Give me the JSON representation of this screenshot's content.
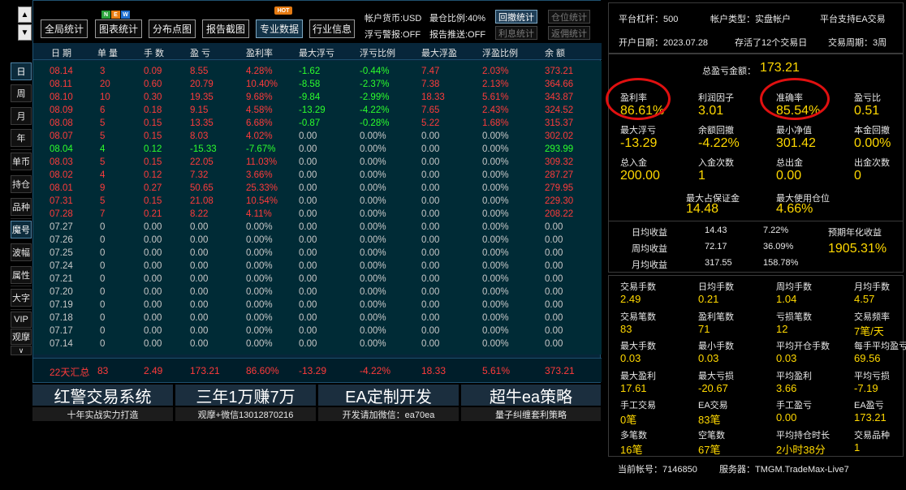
{
  "sidebar": {
    "up_arrow": "▲",
    "down_arrow": "▼",
    "buttons": [
      "日",
      "周",
      "月",
      "年",
      "单币",
      "持仓",
      "品种",
      "魔号",
      "波幅",
      "属性",
      "大字",
      "VIP",
      "观摩"
    ],
    "collapse": "∨"
  },
  "toolbar": {
    "buttons": [
      "全局统计",
      "图表统计",
      "分布点图",
      "报告截图",
      "专业数据",
      "行业信息"
    ],
    "new_badge": [
      "N",
      "E",
      "W"
    ],
    "hot_badge": "HOT",
    "account_currency": "帐户货币:USD",
    "max_position_ratio": "最仓比例:40%",
    "float_loss_alert": "浮亏警报:OFF",
    "report_push": "报告推送:OFF",
    "small_buttons": [
      "回撤统计",
      "仓位统计",
      "利息统计",
      "返佣统计"
    ]
  },
  "table": {
    "headers": [
      "日 期",
      "单 量",
      "手 数",
      "盈 亏",
      "盈利率",
      "最大浮亏",
      "浮亏比例",
      "最大浮盈",
      "浮盈比例",
      "余 额"
    ],
    "rows": [
      [
        "08.14",
        "3",
        "0.09",
        "8.55",
        "4.28%",
        "-1.62",
        "-0.44%",
        "7.47",
        "2.03%",
        "373.21"
      ],
      [
        "08.11",
        "20",
        "0.60",
        "20.79",
        "10.40%",
        "-8.58",
        "-2.37%",
        "7.38",
        "2.13%",
        "364.66"
      ],
      [
        "08.10",
        "10",
        "0.30",
        "19.35",
        "9.68%",
        "-9.84",
        "-2.99%",
        "18.33",
        "5.61%",
        "343.87"
      ],
      [
        "08.09",
        "6",
        "0.18",
        "9.15",
        "4.58%",
        "-13.29",
        "-4.22%",
        "7.65",
        "2.43%",
        "324.52"
      ],
      [
        "08.08",
        "5",
        "0.15",
        "13.35",
        "6.68%",
        "-0.87",
        "-0.28%",
        "5.22",
        "1.68%",
        "315.37"
      ],
      [
        "08.07",
        "5",
        "0.15",
        "8.03",
        "4.02%",
        "0.00",
        "0.00%",
        "0.00",
        "0.00%",
        "302.02"
      ],
      [
        "08.04",
        "4",
        "0.12",
        "-15.33",
        "-7.67%",
        "0.00",
        "0.00%",
        "0.00",
        "0.00%",
        "293.99"
      ],
      [
        "08.03",
        "5",
        "0.15",
        "22.05",
        "11.03%",
        "0.00",
        "0.00%",
        "0.00",
        "0.00%",
        "309.32"
      ],
      [
        "08.02",
        "4",
        "0.12",
        "7.32",
        "3.66%",
        "0.00",
        "0.00%",
        "0.00",
        "0.00%",
        "287.27"
      ],
      [
        "08.01",
        "9",
        "0.27",
        "50.65",
        "25.33%",
        "0.00",
        "0.00%",
        "0.00",
        "0.00%",
        "279.95"
      ],
      [
        "07.31",
        "5",
        "0.15",
        "21.08",
        "10.54%",
        "0.00",
        "0.00%",
        "0.00",
        "0.00%",
        "229.30"
      ],
      [
        "07.28",
        "7",
        "0.21",
        "8.22",
        "4.11%",
        "0.00",
        "0.00%",
        "0.00",
        "0.00%",
        "208.22"
      ],
      [
        "07.27",
        "0",
        "0.00",
        "0.00",
        "0.00%",
        "0.00",
        "0.00%",
        "0.00",
        "0.00%",
        "0.00"
      ],
      [
        "07.26",
        "0",
        "0.00",
        "0.00",
        "0.00%",
        "0.00",
        "0.00%",
        "0.00",
        "0.00%",
        "0.00"
      ],
      [
        "07.25",
        "0",
        "0.00",
        "0.00",
        "0.00%",
        "0.00",
        "0.00%",
        "0.00",
        "0.00%",
        "0.00"
      ],
      [
        "07.24",
        "0",
        "0.00",
        "0.00",
        "0.00%",
        "0.00",
        "0.00%",
        "0.00",
        "0.00%",
        "0.00"
      ],
      [
        "07.21",
        "0",
        "0.00",
        "0.00",
        "0.00%",
        "0.00",
        "0.00%",
        "0.00",
        "0.00%",
        "0.00"
      ],
      [
        "07.20",
        "0",
        "0.00",
        "0.00",
        "0.00%",
        "0.00",
        "0.00%",
        "0.00",
        "0.00%",
        "0.00"
      ],
      [
        "07.19",
        "0",
        "0.00",
        "0.00",
        "0.00%",
        "0.00",
        "0.00%",
        "0.00",
        "0.00%",
        "0.00"
      ],
      [
        "07.18",
        "0",
        "0.00",
        "0.00",
        "0.00%",
        "0.00",
        "0.00%",
        "0.00",
        "0.00%",
        "0.00"
      ],
      [
        "07.17",
        "0",
        "0.00",
        "0.00",
        "0.00%",
        "0.00",
        "0.00%",
        "0.00",
        "0.00%",
        "0.00"
      ],
      [
        "07.14",
        "0",
        "0.00",
        "0.00",
        "0.00%",
        "0.00",
        "0.00%",
        "0.00",
        "0.00%",
        "0.00"
      ]
    ],
    "row_colors": [
      "red",
      "red",
      "red",
      "red",
      "red",
      "red",
      "green",
      "red",
      "red",
      "red",
      "red",
      "red",
      "white",
      "white",
      "white",
      "white",
      "white",
      "white",
      "white",
      "white",
      "white",
      "white"
    ],
    "summary": [
      "22天汇总",
      "83",
      "2.49",
      "173.21",
      "86.60%",
      "-13.29",
      "-4.22%",
      "18.33",
      "5.61%",
      "373.21"
    ]
  },
  "banners": [
    {
      "title": "红警交易系统",
      "sub": "十年实战实力打造"
    },
    {
      "title": "三年1万赚7万",
      "sub": "观摩+微信13012870216"
    },
    {
      "title": "EA定制开发",
      "sub": "开发请加微信：ea70ea"
    },
    {
      "title": "超牛ea策略",
      "sub": "量子纠缠套利策略"
    }
  ],
  "right": {
    "platform_leverage": "平台杠杆：500",
    "account_type": "帐户类型：实盘帐户",
    "ea_support": "平台支持EA交易",
    "open_date": "开户日期：2023.07.28",
    "survival": "存活了12个交易日",
    "trade_period": "交易周期：3周",
    "total_pnl_label": "总盈亏金额：",
    "total_pnl_value": "173.21",
    "stats1": [
      {
        "label": "盈利率",
        "value": "86.61%"
      },
      {
        "label": "利润因子",
        "value": "3.01"
      },
      {
        "label": "准确率",
        "value": "85.54%"
      },
      {
        "label": "盈亏比",
        "value": "0.51"
      },
      {
        "label": "最大浮亏",
        "value": "-13.29"
      },
      {
        "label": "余额回撤",
        "value": "-4.22%"
      },
      {
        "label": "最小净值",
        "value": "301.42"
      },
      {
        "label": "本金回撤",
        "value": "0.00%"
      },
      {
        "label": "总入金",
        "value": "200.00"
      },
      {
        "label": "入金次数",
        "value": "1"
      },
      {
        "label": "总出金",
        "value": "0.00"
      },
      {
        "label": "出金次数",
        "value": "0"
      }
    ],
    "max_margin_label": "最大占保证金",
    "max_margin_value": "14.48",
    "max_position_label": "最大使用仓位",
    "max_position_value": "4.66%",
    "daily_label": "日均收益",
    "daily_value": "14.43",
    "daily_pct": "7.22%",
    "weekly_label": "周均收益",
    "weekly_value": "72.17",
    "weekly_pct": "36.09%",
    "monthly_label": "月均收益",
    "monthly_value": "317.55",
    "monthly_pct": "158.78%",
    "annual_label": "预期年化收益",
    "annual_value": "1905.31%",
    "stats2": [
      {
        "label": "交易手数",
        "value": "2.49"
      },
      {
        "label": "日均手数",
        "value": "0.21"
      },
      {
        "label": "周均手数",
        "value": "1.04"
      },
      {
        "label": "月均手数",
        "value": "4.57"
      },
      {
        "label": "交易笔数",
        "value": "83"
      },
      {
        "label": "盈利笔数",
        "value": "71"
      },
      {
        "label": "亏损笔数",
        "value": "12"
      },
      {
        "label": "交易频率",
        "value": "7笔/天"
      },
      {
        "label": "最大手数",
        "value": "0.03"
      },
      {
        "label": "最小手数",
        "value": "0.03"
      },
      {
        "label": "平均开仓手数",
        "value": "0.03"
      },
      {
        "label": "每手平均盈亏",
        "value": "69.56"
      },
      {
        "label": "最大盈利",
        "value": "17.61"
      },
      {
        "label": "最大亏损",
        "value": "-20.67"
      },
      {
        "label": "平均盈利",
        "value": "3.66"
      },
      {
        "label": "平均亏损",
        "value": "-7.19"
      },
      {
        "label": "手工交易",
        "value": "0笔"
      },
      {
        "label": "EA交易",
        "value": "83笔"
      },
      {
        "label": "手工盈亏",
        "value": "0.00"
      },
      {
        "label": "EA盈亏",
        "value": "173.21"
      },
      {
        "label": "多笔数",
        "value": "16笔"
      },
      {
        "label": "空笔数",
        "value": "67笔"
      },
      {
        "label": "平均持仓时长",
        "value": "2小时38分"
      },
      {
        "label": "交易品种",
        "value": "1"
      }
    ],
    "current_account": "当前帐号：7146850",
    "server": "服务器：TMGM.TradeMax-Live7"
  },
  "colors": {
    "profit": "#ff3b3b",
    "loss": "#2cff2c",
    "value_yellow": "#ffd800",
    "panel_bg": "#07263a",
    "highlight_circle": "#e01010"
  }
}
